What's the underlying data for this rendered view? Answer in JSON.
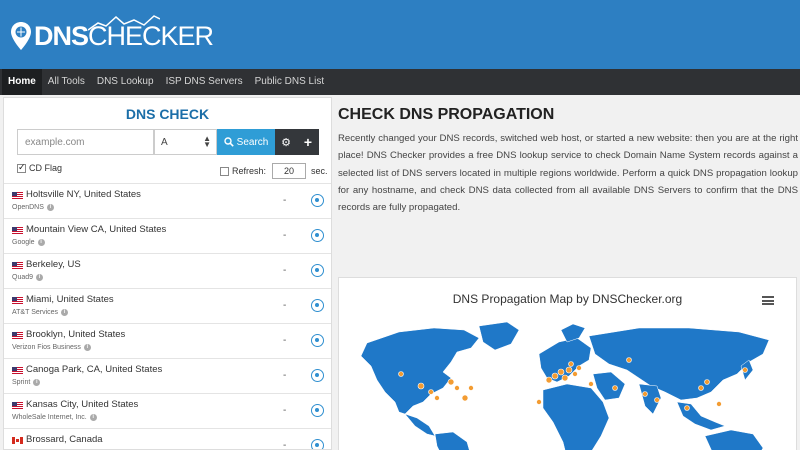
{
  "brand": {
    "logo_part1": "DNS",
    "logo_part2": "CHECKER"
  },
  "nav": [
    {
      "label": "Home",
      "active": true
    },
    {
      "label": "All Tools"
    },
    {
      "label": "DNS Lookup"
    },
    {
      "label": "ISP DNS Servers"
    },
    {
      "label": "Public DNS List"
    }
  ],
  "dns_check": {
    "title": "DNS CHECK",
    "search_placeholder": "example.com",
    "record_type": "A",
    "search_label": "Search",
    "cd_flag_label": "CD Flag",
    "cd_flag_checked": true,
    "refresh_label": "Refresh:",
    "refresh_checked": false,
    "refresh_value": "20",
    "refresh_unit": "sec."
  },
  "servers": [
    {
      "location": "Holtsville NY, United States",
      "provider": "OpenDNS",
      "result": "-",
      "flag": "us"
    },
    {
      "location": "Mountain View CA, United States",
      "provider": "Google",
      "result": "-",
      "flag": "us"
    },
    {
      "location": "Berkeley, US",
      "provider": "Quad9",
      "result": "-",
      "flag": "us"
    },
    {
      "location": "Miami, United States",
      "provider": "AT&T Services",
      "result": "-",
      "flag": "us"
    },
    {
      "location": "Brooklyn, United States",
      "provider": "Verizon Fios Business",
      "result": "-",
      "flag": "us"
    },
    {
      "location": "Canoga Park, CA, United States",
      "provider": "Sprint",
      "result": "-",
      "flag": "us"
    },
    {
      "location": "Kansas City, United States",
      "provider": "WholeSale Internet, Inc.",
      "result": "-",
      "flag": "us"
    },
    {
      "location": "Brossard, Canada",
      "provider": "",
      "result": "-",
      "flag": "ca"
    }
  ],
  "main": {
    "title": "CHECK DNS PROPAGATION",
    "description": "Recently changed your DNS records, switched web host, or started a new website: then you are at the right place! DNS Checker provides a free DNS lookup service to check Domain Name System records against a selected list of DNS servers located in multiple regions worldwide. Perform a quick DNS propagation lookup for any hostname, and check DNS data collected from all available DNS Servers to confirm that the DNS records are fully propagated."
  },
  "map": {
    "title": "DNS Propagation Map by DNSChecker.org",
    "land_color": "#1f78c8",
    "marker_color": "#f39c32"
  }
}
